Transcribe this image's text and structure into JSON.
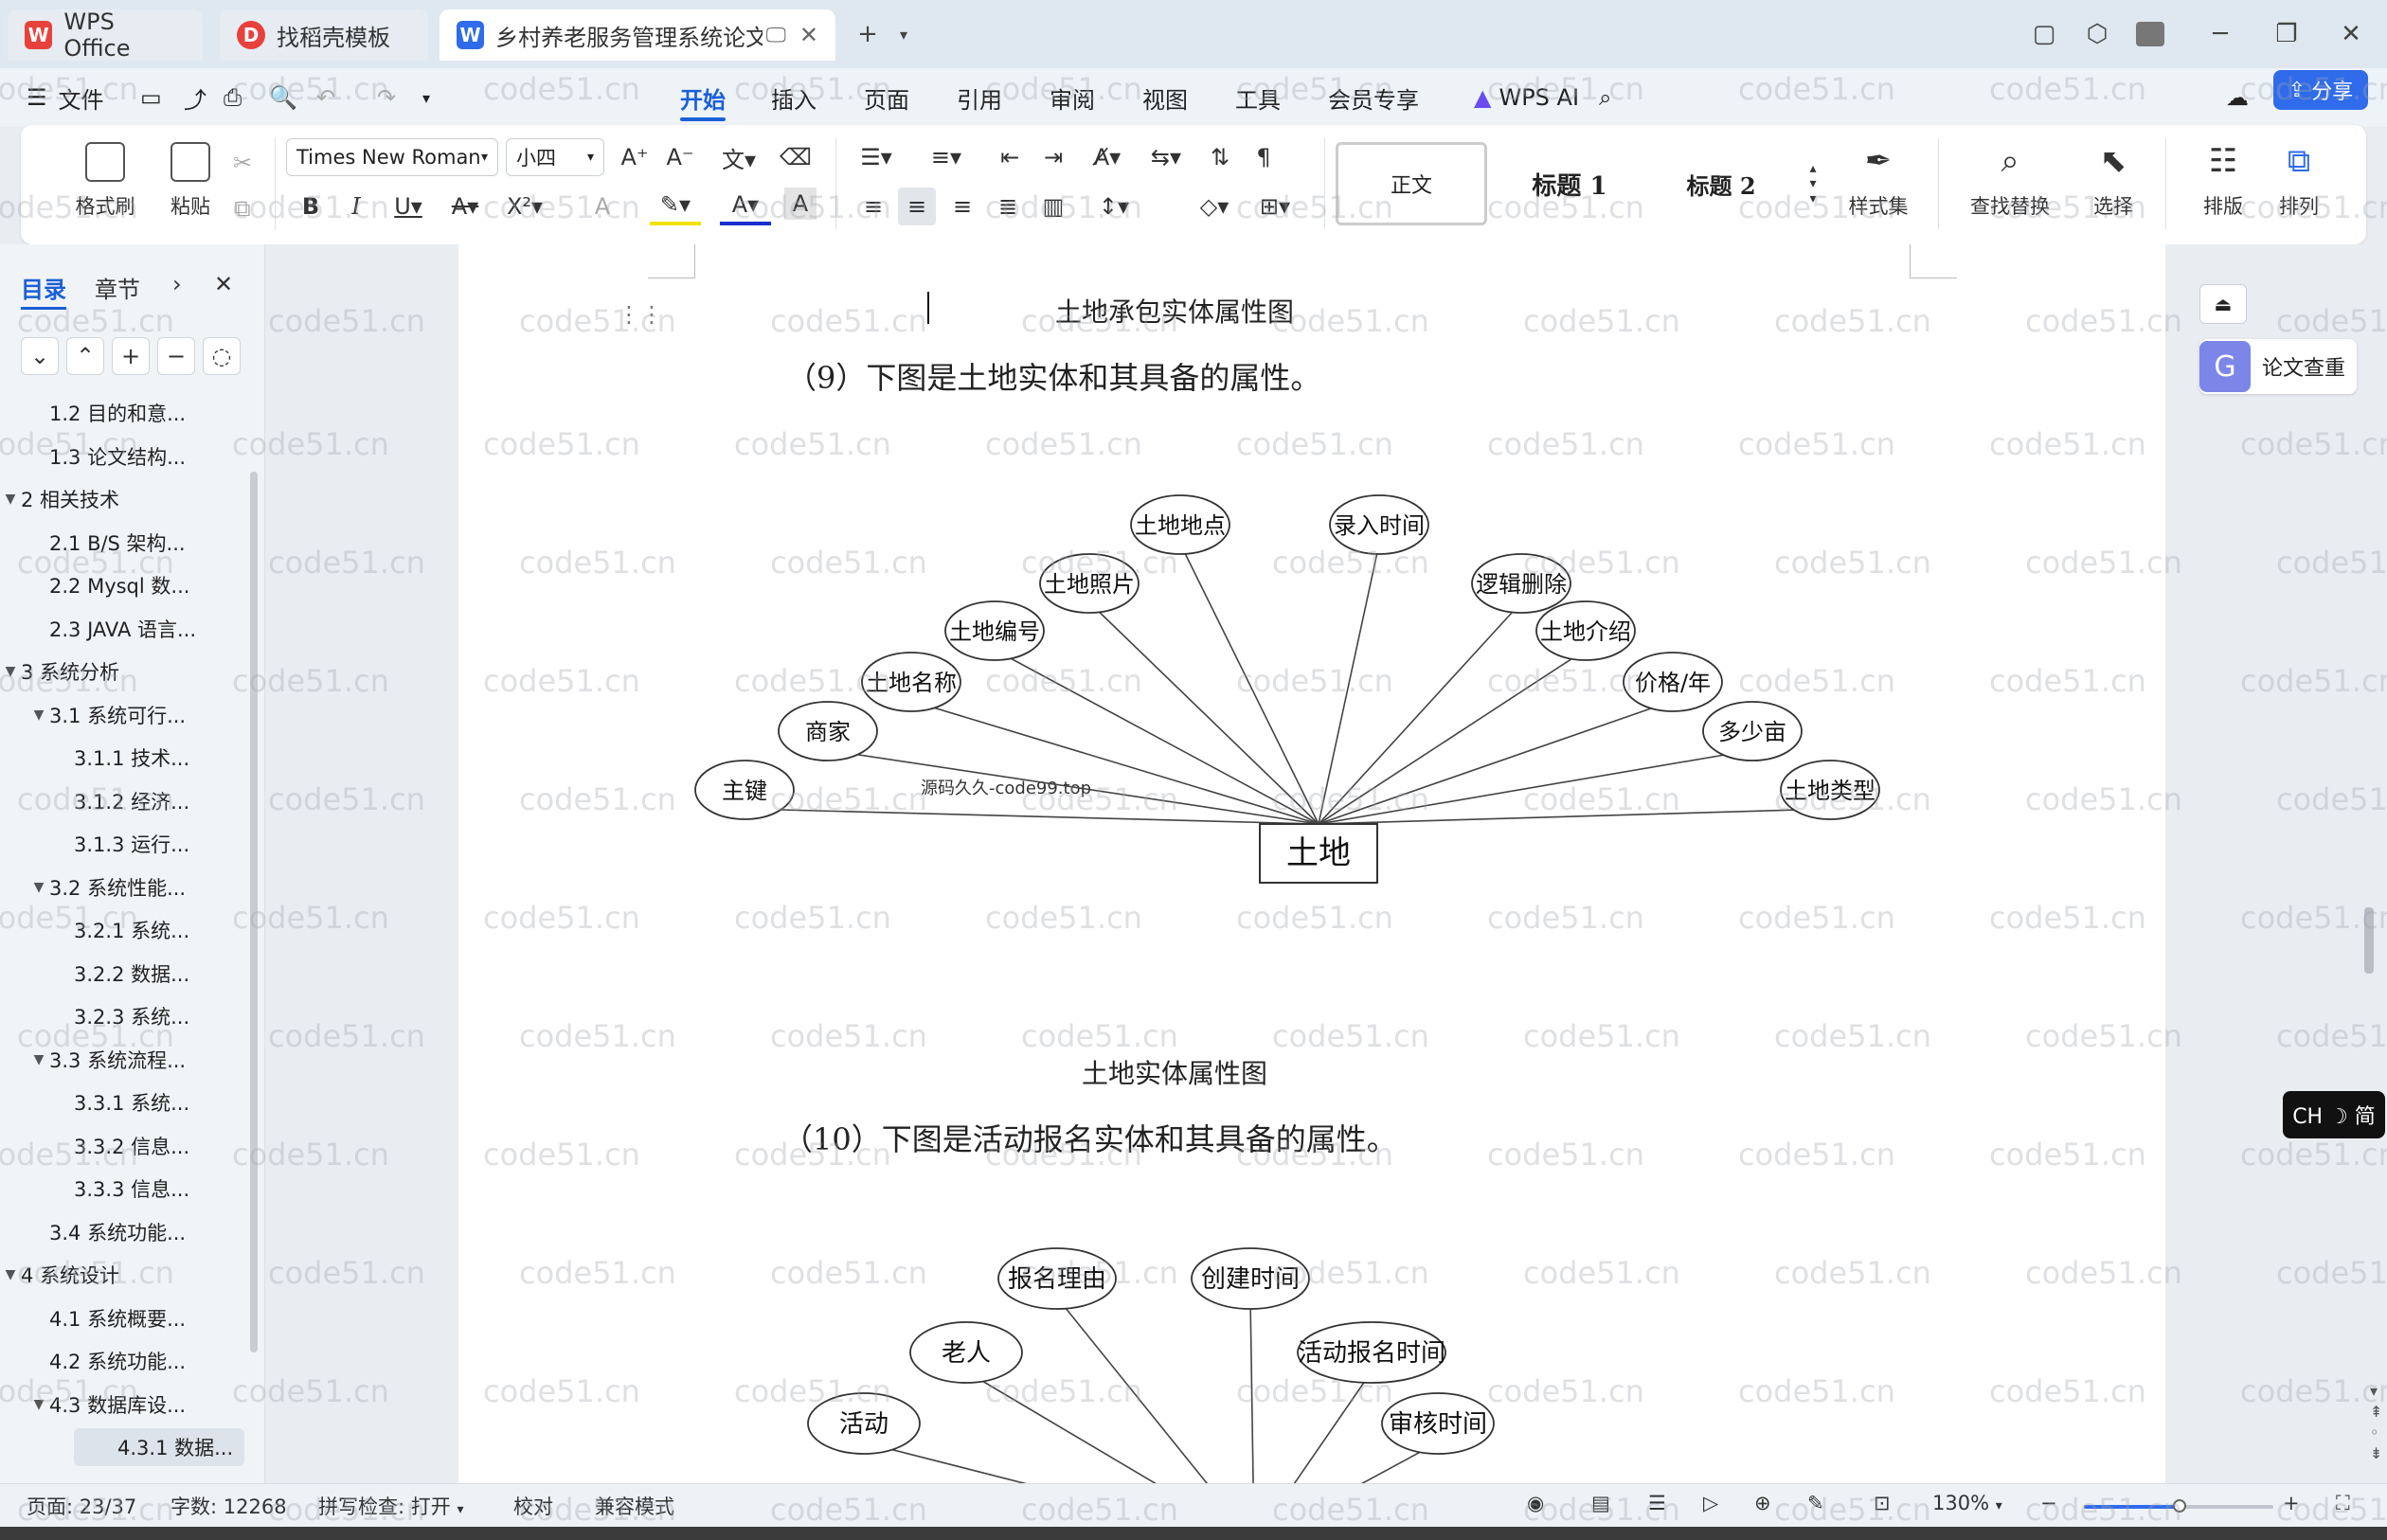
{
  "titlebar": {
    "tabs": [
      {
        "label": "WPS Office",
        "logo": "W"
      },
      {
        "label": "找稻壳模板",
        "logo": "D"
      },
      {
        "label": "乡村养老服务管理系统论文.do",
        "logo": "W"
      }
    ],
    "new_tab": "+"
  },
  "menubar": {
    "file": "文件",
    "items": [
      "开始",
      "插入",
      "页面",
      "引用",
      "审阅",
      "视图",
      "工具",
      "会员专享"
    ],
    "active": "开始",
    "wps_ai": "WPS AI",
    "share": "分享"
  },
  "ribbon": {
    "format_painter": "格式刷",
    "paste": "粘贴",
    "font_name": "Times New Roman",
    "font_size": "小四",
    "styles": [
      "正文",
      "标题 1",
      "标题 2"
    ],
    "style_set": "样式集",
    "find_replace": "查找替换",
    "select": "选择",
    "layout": "排版",
    "arrange": "排列"
  },
  "sidebar": {
    "tabs": [
      "目录",
      "章节"
    ],
    "toc": [
      {
        "label": "1.2 目的和意...",
        "level": 2
      },
      {
        "label": "1.3 论文结构...",
        "level": 2
      },
      {
        "label": "2 相关技术",
        "level": 1
      },
      {
        "label": "2.1 B/S 架构...",
        "level": 2
      },
      {
        "label": "2.2 Mysql 数...",
        "level": 2
      },
      {
        "label": "2.3 JAVA 语言...",
        "level": 2
      },
      {
        "label": "3 系统分析",
        "level": 1
      },
      {
        "label": "3.1 系统可行...",
        "level": 2,
        "expandable": true
      },
      {
        "label": "3.1.1 技术...",
        "level": 3
      },
      {
        "label": "3.1.2 经济...",
        "level": 3
      },
      {
        "label": "3.1.3 运行...",
        "level": 3
      },
      {
        "label": "3.2 系统性能...",
        "level": 2,
        "expandable": true
      },
      {
        "label": "3.2.1 系统...",
        "level": 3
      },
      {
        "label": "3.2.2 数据...",
        "level": 3
      },
      {
        "label": "3.2.3 系统...",
        "level": 3
      },
      {
        "label": "3.3 系统流程...",
        "level": 2,
        "expandable": true
      },
      {
        "label": "3.3.1 系统...",
        "level": 3
      },
      {
        "label": "3.3.2 信息...",
        "level": 3
      },
      {
        "label": "3.3.3 信息...",
        "level": 3
      },
      {
        "label": "3.4 系统功能...",
        "level": 2
      },
      {
        "label": "4 系统设计",
        "level": 1
      },
      {
        "label": "4.1 系统概要...",
        "level": 2
      },
      {
        "label": "4.2 系统功能...",
        "level": 2
      },
      {
        "label": "4.3 数据库设...",
        "level": 2,
        "expandable": true
      },
      {
        "label": "4.3.1 数据...",
        "level": 3,
        "selected": true
      }
    ]
  },
  "document": {
    "caption_prev": "土地承包实体属性图",
    "para9": "（9）下图是土地实体和其具备的属性。",
    "diagram1": {
      "entity": "土地",
      "attributes": [
        "主键",
        "商家",
        "土地名称",
        "土地编号",
        "土地照片",
        "土地地点",
        "录入时间",
        "逻辑删除",
        "土地介绍",
        "价格/年",
        "多少亩",
        "土地类型"
      ],
      "watermark": "源码久久-code99.top"
    },
    "caption1": "土地实体属性图",
    "para10": "（10）下图是活动报名实体和其具备的属性。",
    "diagram2": {
      "attributes": [
        "活动",
        "老人",
        "报名理由",
        "创建时间",
        "活动报名时间",
        "审核时间"
      ]
    }
  },
  "rightbar": {
    "check": "论文查重",
    "ime": "CH ☽ 简"
  },
  "statusbar": {
    "page": "页面: 23/37",
    "words": "字数: 12268",
    "spell": "拼写检查: 打开",
    "proof": "校对",
    "compat": "兼容模式",
    "zoom": "130%"
  },
  "watermark_text": "code51.cn"
}
